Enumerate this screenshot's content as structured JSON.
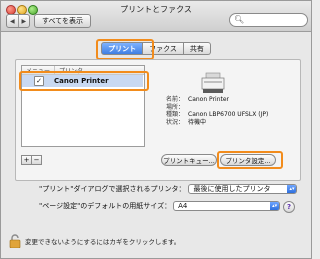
{
  "window": {
    "title": "プリントとファクス",
    "show_all_label": "すべてを表示",
    "nav_back": "◀",
    "nav_forward": "▶"
  },
  "search": {
    "placeholder": ""
  },
  "tabs": [
    {
      "label": "プリント",
      "active": true
    },
    {
      "label": "ファクス",
      "active": false
    },
    {
      "label": "共有",
      "active": false
    }
  ],
  "printer_list": {
    "headers": [
      "メニュー",
      "プリンタ"
    ],
    "items": [
      {
        "name": "Canon Printer",
        "in_menu": true,
        "check": "✓"
      }
    ]
  },
  "printer_info": {
    "rows": [
      {
        "key": "名前：",
        "value": "Canon Printer"
      },
      {
        "key": "場所：",
        "value": ""
      },
      {
        "key": "種類：",
        "value": "Canon LBP6700 UFSLX (JP)"
      },
      {
        "key": "状況：",
        "value": "待機中"
      }
    ]
  },
  "list_controls": {
    "add": "+",
    "remove": "−"
  },
  "buttons": {
    "print_queue": "プリントキュー...",
    "printer_setup": "プリンタ設定..."
  },
  "prefs": {
    "selected_printer_label": "\"プリント\"ダイアログで選択されるプリンタ：",
    "selected_printer_value": "最後に使用したプリンタ",
    "paper_size_label": "\"ページ設定\"のデフォルトの用紙サイズ：",
    "paper_size_value": "A4",
    "help": "?"
  },
  "lock": {
    "message": "変更できないようにするにはカギをクリックします。"
  },
  "colors": {
    "highlight": "#f28c1c",
    "accent": "#3f7fe2"
  }
}
